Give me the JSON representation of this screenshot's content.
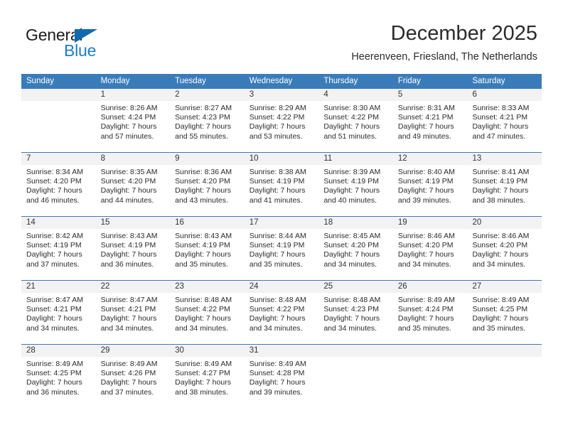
{
  "brand": {
    "name_part1": "General",
    "name_part2": "Blue",
    "triangle_color": "#1269b0",
    "blue_color": "#1d7cc4"
  },
  "header": {
    "title": "December 2025",
    "location": "Heerenveen, Friesland, The Netherlands"
  },
  "theme": {
    "header_blue": "#3a7cb9",
    "daynum_band": "#f2f2f2",
    "text": "#2b2b2b"
  },
  "weekdays": [
    "Sunday",
    "Monday",
    "Tuesday",
    "Wednesday",
    "Thursday",
    "Friday",
    "Saturday"
  ],
  "weeks": [
    [
      {
        "day": "",
        "sunrise": "",
        "sunset": "",
        "daylight_line1": "",
        "daylight_line2": ""
      },
      {
        "day": "1",
        "sunrise": "Sunrise: 8:26 AM",
        "sunset": "Sunset: 4:24 PM",
        "daylight_line1": "Daylight: 7 hours",
        "daylight_line2": "and 57 minutes."
      },
      {
        "day": "2",
        "sunrise": "Sunrise: 8:27 AM",
        "sunset": "Sunset: 4:23 PM",
        "daylight_line1": "Daylight: 7 hours",
        "daylight_line2": "and 55 minutes."
      },
      {
        "day": "3",
        "sunrise": "Sunrise: 8:29 AM",
        "sunset": "Sunset: 4:22 PM",
        "daylight_line1": "Daylight: 7 hours",
        "daylight_line2": "and 53 minutes."
      },
      {
        "day": "4",
        "sunrise": "Sunrise: 8:30 AM",
        "sunset": "Sunset: 4:22 PM",
        "daylight_line1": "Daylight: 7 hours",
        "daylight_line2": "and 51 minutes."
      },
      {
        "day": "5",
        "sunrise": "Sunrise: 8:31 AM",
        "sunset": "Sunset: 4:21 PM",
        "daylight_line1": "Daylight: 7 hours",
        "daylight_line2": "and 49 minutes."
      },
      {
        "day": "6",
        "sunrise": "Sunrise: 8:33 AM",
        "sunset": "Sunset: 4:21 PM",
        "daylight_line1": "Daylight: 7 hours",
        "daylight_line2": "and 47 minutes."
      }
    ],
    [
      {
        "day": "7",
        "sunrise": "Sunrise: 8:34 AM",
        "sunset": "Sunset: 4:20 PM",
        "daylight_line1": "Daylight: 7 hours",
        "daylight_line2": "and 46 minutes."
      },
      {
        "day": "8",
        "sunrise": "Sunrise: 8:35 AM",
        "sunset": "Sunset: 4:20 PM",
        "daylight_line1": "Daylight: 7 hours",
        "daylight_line2": "and 44 minutes."
      },
      {
        "day": "9",
        "sunrise": "Sunrise: 8:36 AM",
        "sunset": "Sunset: 4:20 PM",
        "daylight_line1": "Daylight: 7 hours",
        "daylight_line2": "and 43 minutes."
      },
      {
        "day": "10",
        "sunrise": "Sunrise: 8:38 AM",
        "sunset": "Sunset: 4:19 PM",
        "daylight_line1": "Daylight: 7 hours",
        "daylight_line2": "and 41 minutes."
      },
      {
        "day": "11",
        "sunrise": "Sunrise: 8:39 AM",
        "sunset": "Sunset: 4:19 PM",
        "daylight_line1": "Daylight: 7 hours",
        "daylight_line2": "and 40 minutes."
      },
      {
        "day": "12",
        "sunrise": "Sunrise: 8:40 AM",
        "sunset": "Sunset: 4:19 PM",
        "daylight_line1": "Daylight: 7 hours",
        "daylight_line2": "and 39 minutes."
      },
      {
        "day": "13",
        "sunrise": "Sunrise: 8:41 AM",
        "sunset": "Sunset: 4:19 PM",
        "daylight_line1": "Daylight: 7 hours",
        "daylight_line2": "and 38 minutes."
      }
    ],
    [
      {
        "day": "14",
        "sunrise": "Sunrise: 8:42 AM",
        "sunset": "Sunset: 4:19 PM",
        "daylight_line1": "Daylight: 7 hours",
        "daylight_line2": "and 37 minutes."
      },
      {
        "day": "15",
        "sunrise": "Sunrise: 8:43 AM",
        "sunset": "Sunset: 4:19 PM",
        "daylight_line1": "Daylight: 7 hours",
        "daylight_line2": "and 36 minutes."
      },
      {
        "day": "16",
        "sunrise": "Sunrise: 8:43 AM",
        "sunset": "Sunset: 4:19 PM",
        "daylight_line1": "Daylight: 7 hours",
        "daylight_line2": "and 35 minutes."
      },
      {
        "day": "17",
        "sunrise": "Sunrise: 8:44 AM",
        "sunset": "Sunset: 4:19 PM",
        "daylight_line1": "Daylight: 7 hours",
        "daylight_line2": "and 35 minutes."
      },
      {
        "day": "18",
        "sunrise": "Sunrise: 8:45 AM",
        "sunset": "Sunset: 4:20 PM",
        "daylight_line1": "Daylight: 7 hours",
        "daylight_line2": "and 34 minutes."
      },
      {
        "day": "19",
        "sunrise": "Sunrise: 8:46 AM",
        "sunset": "Sunset: 4:20 PM",
        "daylight_line1": "Daylight: 7 hours",
        "daylight_line2": "and 34 minutes."
      },
      {
        "day": "20",
        "sunrise": "Sunrise: 8:46 AM",
        "sunset": "Sunset: 4:20 PM",
        "daylight_line1": "Daylight: 7 hours",
        "daylight_line2": "and 34 minutes."
      }
    ],
    [
      {
        "day": "21",
        "sunrise": "Sunrise: 8:47 AM",
        "sunset": "Sunset: 4:21 PM",
        "daylight_line1": "Daylight: 7 hours",
        "daylight_line2": "and 34 minutes."
      },
      {
        "day": "22",
        "sunrise": "Sunrise: 8:47 AM",
        "sunset": "Sunset: 4:21 PM",
        "daylight_line1": "Daylight: 7 hours",
        "daylight_line2": "and 34 minutes."
      },
      {
        "day": "23",
        "sunrise": "Sunrise: 8:48 AM",
        "sunset": "Sunset: 4:22 PM",
        "daylight_line1": "Daylight: 7 hours",
        "daylight_line2": "and 34 minutes."
      },
      {
        "day": "24",
        "sunrise": "Sunrise: 8:48 AM",
        "sunset": "Sunset: 4:22 PM",
        "daylight_line1": "Daylight: 7 hours",
        "daylight_line2": "and 34 minutes."
      },
      {
        "day": "25",
        "sunrise": "Sunrise: 8:48 AM",
        "sunset": "Sunset: 4:23 PM",
        "daylight_line1": "Daylight: 7 hours",
        "daylight_line2": "and 34 minutes."
      },
      {
        "day": "26",
        "sunrise": "Sunrise: 8:49 AM",
        "sunset": "Sunset: 4:24 PM",
        "daylight_line1": "Daylight: 7 hours",
        "daylight_line2": "and 35 minutes."
      },
      {
        "day": "27",
        "sunrise": "Sunrise: 8:49 AM",
        "sunset": "Sunset: 4:25 PM",
        "daylight_line1": "Daylight: 7 hours",
        "daylight_line2": "and 35 minutes."
      }
    ],
    [
      {
        "day": "28",
        "sunrise": "Sunrise: 8:49 AM",
        "sunset": "Sunset: 4:25 PM",
        "daylight_line1": "Daylight: 7 hours",
        "daylight_line2": "and 36 minutes."
      },
      {
        "day": "29",
        "sunrise": "Sunrise: 8:49 AM",
        "sunset": "Sunset: 4:26 PM",
        "daylight_line1": "Daylight: 7 hours",
        "daylight_line2": "and 37 minutes."
      },
      {
        "day": "30",
        "sunrise": "Sunrise: 8:49 AM",
        "sunset": "Sunset: 4:27 PM",
        "daylight_line1": "Daylight: 7 hours",
        "daylight_line2": "and 38 minutes."
      },
      {
        "day": "31",
        "sunrise": "Sunrise: 8:49 AM",
        "sunset": "Sunset: 4:28 PM",
        "daylight_line1": "Daylight: 7 hours",
        "daylight_line2": "and 39 minutes."
      },
      {
        "day": "",
        "sunrise": "",
        "sunset": "",
        "daylight_line1": "",
        "daylight_line2": ""
      },
      {
        "day": "",
        "sunrise": "",
        "sunset": "",
        "daylight_line1": "",
        "daylight_line2": ""
      },
      {
        "day": "",
        "sunrise": "",
        "sunset": "",
        "daylight_line1": "",
        "daylight_line2": ""
      }
    ]
  ]
}
